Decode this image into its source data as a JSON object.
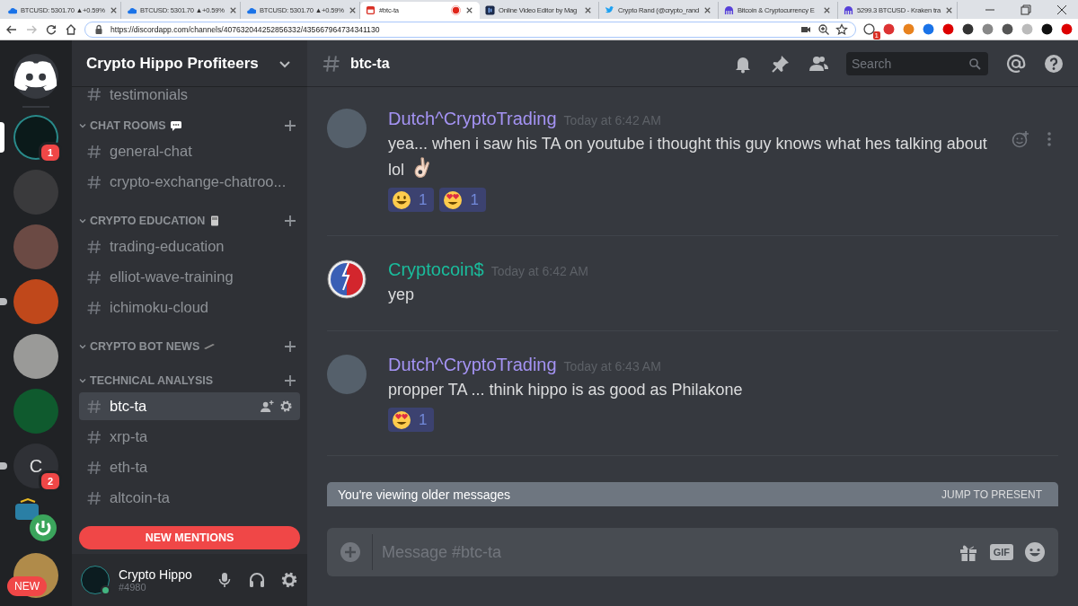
{
  "browser": {
    "tabs": [
      {
        "kind": "cloud",
        "title": "BTCUSD: 5301.70 ▲+0.59%",
        "selected": false
      },
      {
        "kind": "cloud",
        "title": "BTCUSD: 5301.70 ▲+0.59%",
        "selected": false
      },
      {
        "kind": "cloud",
        "title": "BTCUSD: 5301.70 ▲+0.59%",
        "selected": false
      },
      {
        "kind": "discord",
        "title": "#btc-ta",
        "selected": true,
        "recording": true
      },
      {
        "kind": "video",
        "title": "Online Video Editor by Mag",
        "selected": false
      },
      {
        "kind": "bird",
        "title": "Crypto Rand (@crypto_rand",
        "selected": false
      },
      {
        "kind": "kraken",
        "title": "Bitcoin & Cryptocurrency E",
        "selected": false
      },
      {
        "kind": "kraken",
        "title": "5299.3 BTCUSD - Kraken tra",
        "selected": false
      }
    ],
    "url": "https://discordapp.com/channels/407632044252856332/435667964734341130",
    "extension_badge": "1"
  },
  "servers": [
    {
      "kind": "home",
      "selected": false,
      "unread": false
    },
    {
      "kind": "photo",
      "selected": true,
      "unread": false,
      "badge": "1",
      "color": "#0b1a1a"
    },
    {
      "kind": "photo",
      "selected": false,
      "unread": false,
      "color": "#3a3a3c"
    },
    {
      "kind": "photo",
      "selected": false,
      "unread": false,
      "color": "#6b4a44"
    },
    {
      "kind": "photo",
      "selected": false,
      "unread": true,
      "color": "#c0481b"
    },
    {
      "kind": "photo",
      "selected": false,
      "unread": false,
      "color": "#9a9a98"
    },
    {
      "kind": "photo",
      "selected": false,
      "unread": false,
      "color": "#0f5a2e"
    },
    {
      "kind": "letter",
      "label": "C",
      "selected": false,
      "unread": true,
      "badge": "2"
    },
    {
      "kind": "app",
      "selected": false,
      "unread": false
    },
    {
      "kind": "photo",
      "selected": false,
      "unread": false,
      "color": "#b08b4a",
      "new_label": "NEW"
    }
  ],
  "guild": {
    "name": "Crypto Hippo Profiteers",
    "channels_top": [
      {
        "name": "testimonials",
        "selected": false
      }
    ],
    "categories": [
      {
        "name": "CHAT ROOMS",
        "kind": "speech",
        "expanded": true,
        "channels": [
          {
            "name": "general-chat",
            "selected": false
          },
          {
            "name": "crypto-exchange-chatroo...",
            "selected": false
          }
        ]
      },
      {
        "name": "CRYPTO EDUCATION",
        "kind": "book",
        "expanded": true,
        "channels": [
          {
            "name": "trading-education",
            "selected": false
          },
          {
            "name": "elliot-wave-training",
            "selected": false
          },
          {
            "name": "ichimoku-cloud",
            "selected": false
          }
        ]
      },
      {
        "name": "CRYPTO BOT NEWS",
        "kind": "pen",
        "expanded": true
      },
      {
        "name": "TECHNICAL ANALYSIS",
        "kind": "plain",
        "expanded": true,
        "channels": [
          {
            "name": "btc-ta",
            "selected": true
          },
          {
            "name": "xrp-ta",
            "selected": false
          },
          {
            "name": "eth-ta",
            "selected": false
          },
          {
            "name": "altcoin-ta",
            "selected": false
          }
        ]
      }
    ],
    "new_mentions": "NEW MENTIONS",
    "user": {
      "name": "Crypto Hippo",
      "tag": "#4980"
    }
  },
  "channel": {
    "name": "btc-ta",
    "search": {
      "placeholder": "Search"
    }
  },
  "messages": [
    {
      "author": "Dutch^CryptoTrading",
      "color": "#a493f3",
      "kind": "photo",
      "time": "Today at 6:42 AM",
      "text": "yea... when i saw his TA on youtube i thought this guy knows what hes talking about lol",
      "inline_emojis": [
        {
          "kind": "ok_hand"
        }
      ],
      "hovered": true,
      "reactions": [
        {
          "kind": "smile",
          "count": "1"
        },
        {
          "kind": "heart_eyes",
          "count": "1"
        }
      ]
    },
    {
      "author": "Cryptocoin$",
      "color": "#1abc9c",
      "kind": "logo",
      "time": "Today at 6:42 AM",
      "text": "yep",
      "hovered": false
    },
    {
      "author": "Dutch^CryptoTrading",
      "color": "#a493f3",
      "kind": "photo",
      "time": "Today at 6:43 AM",
      "text": "propper TA ... think hippo is as good as Philakone",
      "hovered": false,
      "reactions": [
        {
          "kind": "heart_eyes",
          "count": "1"
        }
      ]
    }
  ],
  "older_bar": {
    "text": "You're viewing older messages",
    "action": "JUMP TO PRESENT"
  },
  "composer": {
    "placeholder": "Message #btc-ta",
    "gif_label": "GIF"
  }
}
